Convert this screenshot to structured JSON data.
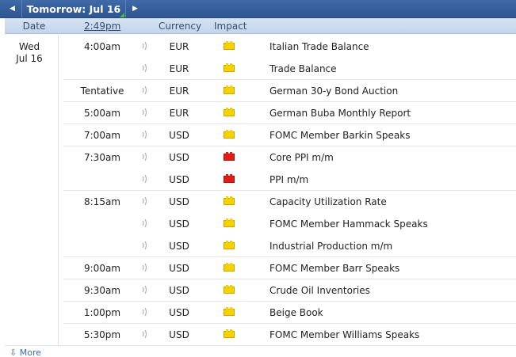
{
  "nav": {
    "prev_glyph": "◀",
    "title": "Tomorrow: Jul 16",
    "next_glyph": "▶"
  },
  "columns": {
    "date": "Date",
    "time": "2:49pm",
    "currency": "Currency",
    "impact": "Impact"
  },
  "day": {
    "weekday": "Wed",
    "date": "Jul 16"
  },
  "colors": {
    "nav_bg": "#2e5690",
    "impact_medium": "#f7d200",
    "impact_high": "#e21b14",
    "link": "#3b6ab0"
  },
  "events": [
    {
      "time": "4:00am",
      "currency": "EUR",
      "impact": "medium",
      "event": "Italian Trade Balance"
    },
    {
      "time": "",
      "currency": "EUR",
      "impact": "medium",
      "event": "Trade Balance"
    },
    {
      "time": "Tentative",
      "currency": "EUR",
      "impact": "medium",
      "event": "German 30-y Bond Auction"
    },
    {
      "time": "5:00am",
      "currency": "EUR",
      "impact": "medium",
      "event": "German Buba Monthly Report"
    },
    {
      "time": "7:00am",
      "currency": "USD",
      "impact": "medium",
      "event": "FOMC Member Barkin Speaks"
    },
    {
      "time": "7:30am",
      "currency": "USD",
      "impact": "high",
      "event": "Core PPI m/m"
    },
    {
      "time": "",
      "currency": "USD",
      "impact": "high",
      "event": "PPI m/m"
    },
    {
      "time": "8:15am",
      "currency": "USD",
      "impact": "medium",
      "event": "Capacity Utilization Rate"
    },
    {
      "time": "",
      "currency": "USD",
      "impact": "medium",
      "event": "FOMC Member Hammack Speaks"
    },
    {
      "time": "",
      "currency": "USD",
      "impact": "medium",
      "event": "Industrial Production m/m"
    },
    {
      "time": "9:00am",
      "currency": "USD",
      "impact": "medium",
      "event": "FOMC Member Barr Speaks"
    },
    {
      "time": "9:30am",
      "currency": "USD",
      "impact": "medium",
      "event": "Crude Oil Inventories"
    },
    {
      "time": "1:00pm",
      "currency": "USD",
      "impact": "medium",
      "event": "Beige Book"
    },
    {
      "time": "5:30pm",
      "currency": "USD",
      "impact": "medium",
      "event": "FOMC Member Williams Speaks"
    }
  ],
  "footer": {
    "more_label": "More",
    "more_icon": "download-arrow-icon"
  }
}
